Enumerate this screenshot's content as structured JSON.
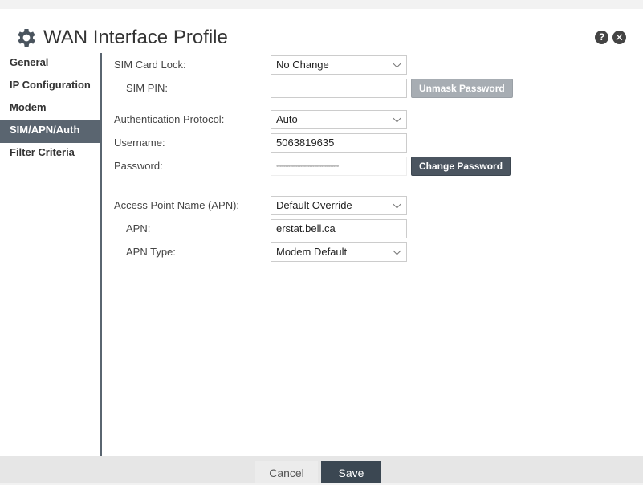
{
  "dialog": {
    "title": "WAN Interface Profile",
    "icons": {
      "settings": "gear-icon",
      "help": "help-icon",
      "close": "close-icon"
    },
    "help_glyph": "?",
    "close_glyph": "✕"
  },
  "sidebar": {
    "items": [
      {
        "label": "General",
        "active": false
      },
      {
        "label": "IP Configuration",
        "active": false
      },
      {
        "label": "Modem",
        "active": false
      },
      {
        "label": "SIM/APN/Auth",
        "active": true
      },
      {
        "label": "Filter Criteria",
        "active": false
      }
    ]
  },
  "form": {
    "sim_card_lock": {
      "label": "SIM Card Lock:",
      "value": "No Change"
    },
    "sim_pin": {
      "label": "SIM PIN:",
      "value": "",
      "button": "Unmask Password"
    },
    "auth_protocol": {
      "label": "Authentication Protocol:",
      "value": "Auto"
    },
    "username": {
      "label": "Username:",
      "value": "5063819635"
    },
    "password": {
      "label": "Password:",
      "value": "••••••••••••••••••••••••••••••••••••",
      "button": "Change Password"
    },
    "apn_mode": {
      "label": "Access Point Name (APN):",
      "value": "Default Override"
    },
    "apn": {
      "label": "APN:",
      "value": "erstat.bell.ca"
    },
    "apn_type": {
      "label": "APN Type:",
      "value": "Modem Default"
    }
  },
  "footer": {
    "cancel": "Cancel",
    "save": "Save"
  },
  "colors": {
    "accent": "#4b5560",
    "active_nav": "#5a6570",
    "disabled_button": "#a7adb3"
  }
}
